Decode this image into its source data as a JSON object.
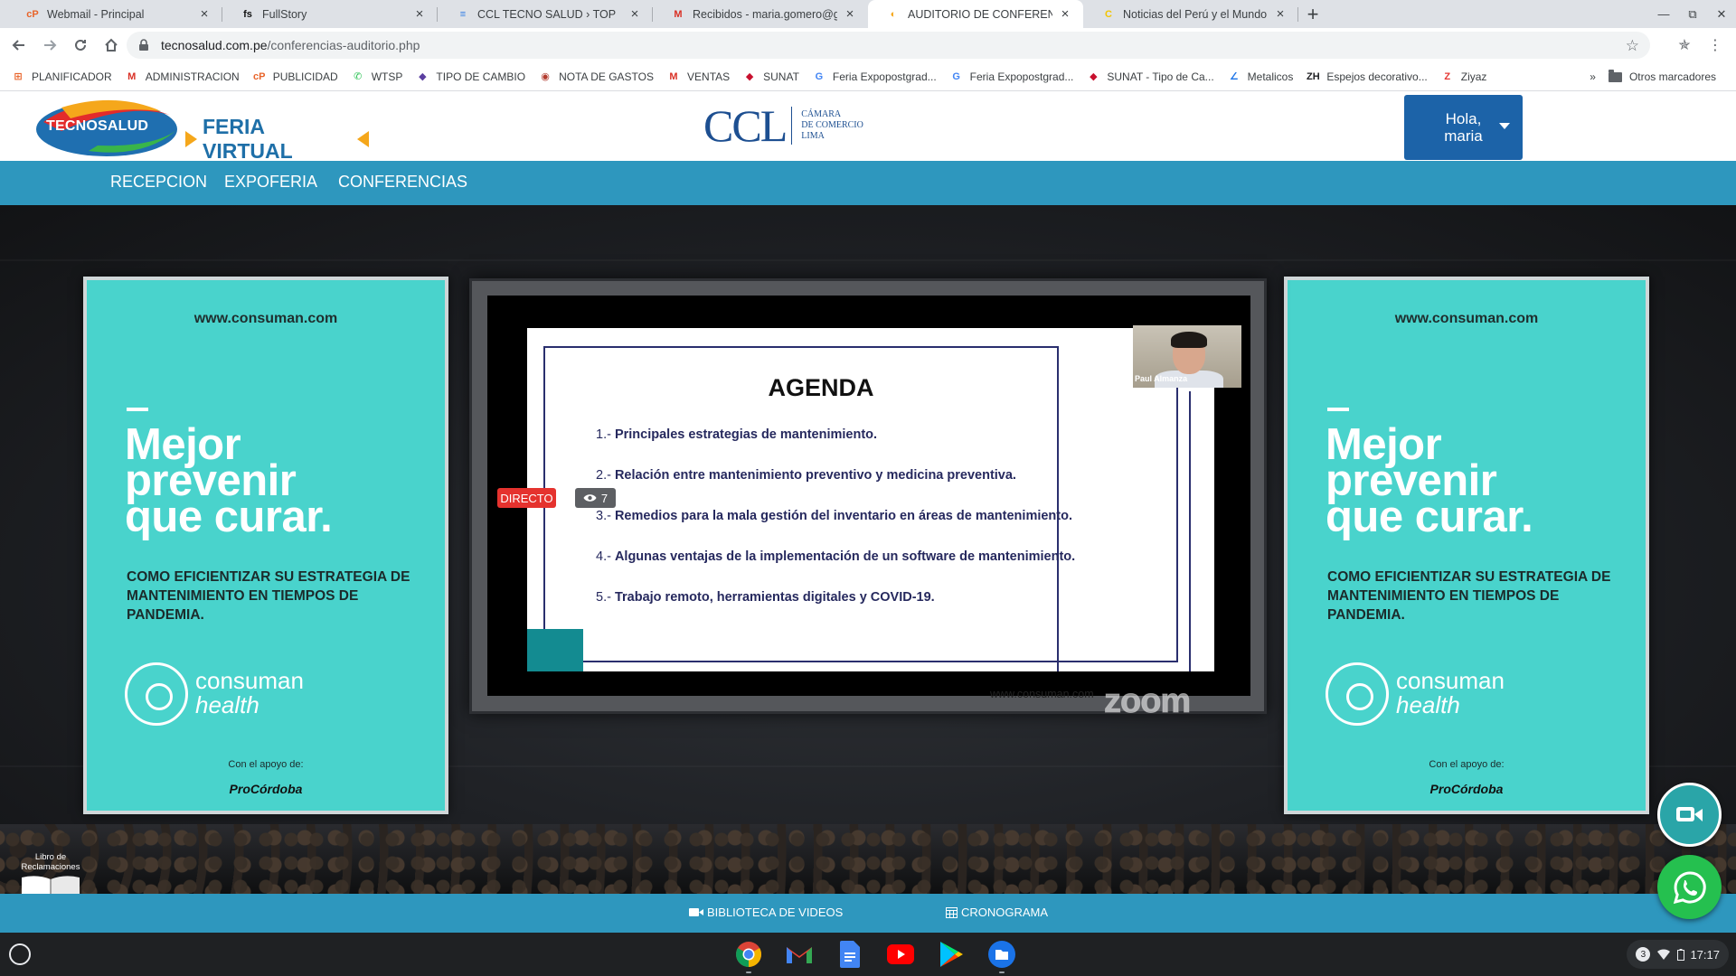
{
  "browser": {
    "tabs": [
      {
        "title": "Webmail - Principal",
        "icon": "cpanel-icon",
        "color": "#e8642a",
        "glyph": "cP",
        "active": false
      },
      {
        "title": "FullStory",
        "icon": "fullstory-icon",
        "color": "#111111",
        "glyph": "fs",
        "active": false
      },
      {
        "title": "CCL TECNO SALUD › TOP",
        "icon": "jira-icon",
        "color": "#2d7be5",
        "glyph": "≡",
        "active": false
      },
      {
        "title": "Recibidos - maria.gomero@grup",
        "icon": "gmail-icon",
        "color": "#d93025",
        "glyph": "M",
        "active": false
      },
      {
        "title": "AUDITORIO DE CONFERENCIAS",
        "icon": "tecnosalud-icon",
        "color": "#f5a71b",
        "glyph": "◐",
        "active": true
      },
      {
        "title": "Noticias del Perú y el Mundo | Co",
        "icon": "elcomercio-icon",
        "color": "#f2c500",
        "glyph": "C",
        "active": false
      }
    ],
    "url_host": "tecnosalud.com.pe",
    "url_path": "/conferencias-auditorio.php",
    "bookmarks": [
      {
        "label": "PLANIFICADOR",
        "icon": "planner-icon",
        "color": "#e8642a",
        "glyph": "⊞"
      },
      {
        "label": "ADMINISTRACION",
        "icon": "gmail-icon",
        "color": "#d93025",
        "glyph": "M"
      },
      {
        "label": "PUBLICIDAD",
        "icon": "cpanel-icon",
        "color": "#e8642a",
        "glyph": "cP"
      },
      {
        "label": "WTSP",
        "icon": "whatsapp-icon",
        "color": "#25c04f",
        "glyph": "✆"
      },
      {
        "label": "TIPO DE CAMBIO",
        "icon": "exchange-icon",
        "color": "#5b3fa0",
        "glyph": "◆"
      },
      {
        "label": "NOTA DE GASTOS",
        "icon": "notes-icon",
        "color": "#b23b2e",
        "glyph": "◉"
      },
      {
        "label": "VENTAS",
        "icon": "gmail-icon",
        "color": "#d93025",
        "glyph": "M"
      },
      {
        "label": "SUNAT",
        "icon": "sunat-icon",
        "color": "#c8102e",
        "glyph": "◆"
      },
      {
        "label": "Feria Expopostgrad...",
        "icon": "google-icon",
        "color": "#4285f4",
        "glyph": "G"
      },
      {
        "label": "Feria Expopostgrad...",
        "icon": "google-icon",
        "color": "#4285f4",
        "glyph": "G"
      },
      {
        "label": "SUNAT - Tipo de Ca...",
        "icon": "sunat-icon",
        "color": "#c8102e",
        "glyph": "◆"
      },
      {
        "label": "Metalicos",
        "icon": "brush-icon",
        "color": "#1a73e8",
        "glyph": "∠"
      },
      {
        "label": "Espejos decorativo...",
        "icon": "zh-icon",
        "color": "#202124",
        "glyph": "ZH"
      },
      {
        "label": "Ziyaz",
        "icon": "ziyaz-icon",
        "color": "#e53935",
        "glyph": "Z"
      }
    ],
    "bookmarks_overflow": "»",
    "other_bookmarks": "Otros marcadores"
  },
  "site": {
    "logo_text": "TECNOSALUD",
    "logo_tagline": "FERIA VIRTUAL",
    "ccl_big": "CCL",
    "ccl_small": [
      "CÁMARA",
      "DE COMERCIO",
      "LIMA"
    ],
    "user_greeting": "Hola,",
    "user_name": "maria",
    "nav": [
      "RECEPCION",
      "EXPOFERIA",
      "CONFERENCIAS"
    ]
  },
  "banners": {
    "url": "www.consuman.com",
    "headline": [
      "Mejor",
      "prevenir",
      "que curar."
    ],
    "subtitle": "COMO EFICIENTIZAR SU ESTRATEGIA DE MANTENIMIENTO EN TIEMPOS DE PANDEMIA.",
    "brand_line1": "consuman",
    "brand_line2": "health",
    "support": "Con el apoyo de:",
    "sponsor": "ProCórdoba"
  },
  "stream": {
    "live_label": "DIRECTO",
    "viewers": "7",
    "speaker": "Paul Almanza",
    "slide_title": "AGENDA",
    "items": [
      {
        "num": "1.-",
        "text": "Principales estrategias de mantenimiento."
      },
      {
        "num": "2.-",
        "text": "Relación entre mantenimiento preventivo y medicina preventiva."
      },
      {
        "num": "3.-",
        "text": "Remedios para la mala gestión del inventario en áreas de mantenimiento."
      },
      {
        "num": "4.-",
        "text": "Algunas ventajas de la implementación de un software de mantenimiento."
      },
      {
        "num": "5.-",
        "text": "Trabajo remoto, herramientas digitales y COVID-19."
      }
    ],
    "slide_footer": "www.consuman.com",
    "watermark": "zoom"
  },
  "footer": {
    "libro": "Libro de Reclamaciones",
    "videos": "BIBLIOTECA DE VIDEOS",
    "cronograma": "CRONOGRAMA"
  },
  "shelf": {
    "notifications": "3",
    "time": "17:17"
  },
  "colors": {
    "nav_blue": "#2e97be",
    "banner_teal": "#49d3cc",
    "live_red": "#e5322e",
    "whatsapp_green": "#25c04f"
  }
}
